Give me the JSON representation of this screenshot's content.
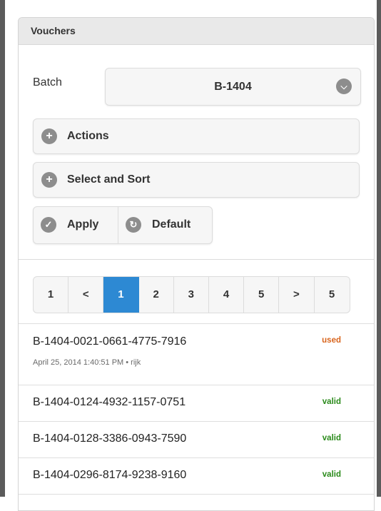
{
  "panel": {
    "title": "Vouchers"
  },
  "batch": {
    "label": "Batch",
    "value": "B-1404",
    "icon": "chevron-down-circle-icon"
  },
  "sections": [
    {
      "label": "Actions",
      "icon": "plus-circle-icon"
    },
    {
      "label": "Select and Sort",
      "icon": "plus-circle-icon"
    }
  ],
  "buttons": {
    "apply": {
      "label": "Apply",
      "icon": "check-circle-icon"
    },
    "default": {
      "label": "Default",
      "icon": "refresh-circle-icon"
    }
  },
  "pagination": {
    "items": [
      "1",
      "<",
      "1",
      "2",
      "3",
      "4",
      "5",
      ">",
      "5"
    ],
    "active_index": 2
  },
  "vouchers": [
    {
      "code": "B-1404-0021-0661-4775-7916",
      "meta": "April 25, 2014 1:40:51 PM • rijk",
      "status": "used"
    },
    {
      "code": "B-1404-0124-4932-1157-0751",
      "meta": "",
      "status": "valid"
    },
    {
      "code": "B-1404-0128-3386-0943-7590",
      "meta": "",
      "status": "valid"
    },
    {
      "code": "B-1404-0296-8174-9238-9160",
      "meta": "",
      "status": "valid"
    }
  ],
  "colors": {
    "accent": "#2d89d3",
    "used": "#d8641c",
    "valid": "#2a8a1a"
  }
}
